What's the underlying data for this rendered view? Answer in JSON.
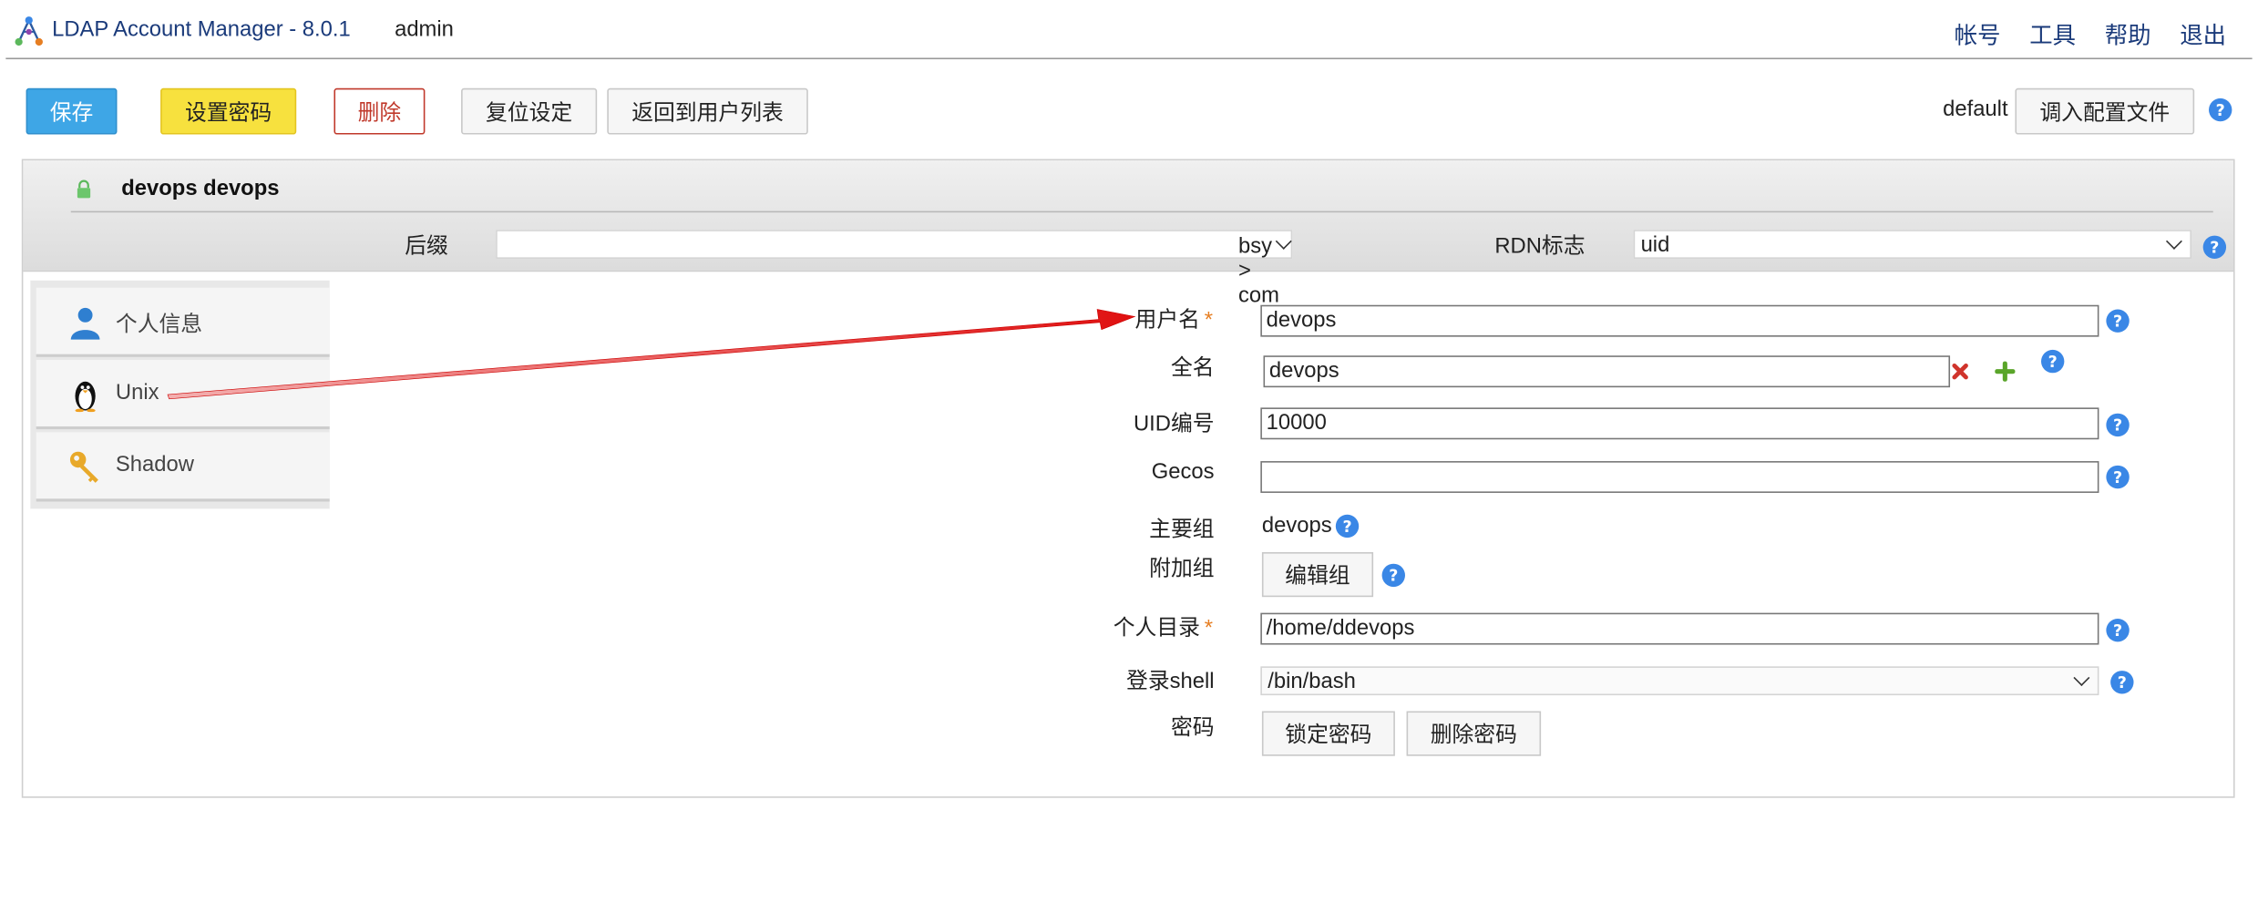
{
  "app": {
    "title": "LDAP Account Manager - 8.0.1",
    "user": "admin"
  },
  "nav": [
    "帐号",
    "工具",
    "帮助",
    "退出"
  ],
  "toolbar": {
    "save": "保存",
    "set_password": "设置密码",
    "delete": "删除",
    "reset": "复位设定",
    "back": "返回到用户列表",
    "profile_name": "default",
    "load_profile": "调入配置文件"
  },
  "entry": {
    "title": "devops devops",
    "suffix_label": "后缀",
    "suffix_value": "bsy > com",
    "rdn_label": "RDN标志",
    "rdn_value": "uid"
  },
  "tabs": [
    {
      "label": "个人信息",
      "icon": "person-icon"
    },
    {
      "label": "Unix",
      "icon": "penguin-icon"
    },
    {
      "label": "Shadow",
      "icon": "key-icon"
    }
  ],
  "form": {
    "username_label": "用户名",
    "username": "devops",
    "fullname_label": "全名",
    "fullname": "devops",
    "uid_label": "UID编号",
    "uid": "10000",
    "gecos_label": "Gecos",
    "gecos": "",
    "primary_group_label": "主要组",
    "primary_group": "devops",
    "additional_groups_label": "附加组",
    "edit_groups": "编辑组",
    "home_label": "个人目录",
    "home": "/home/ddevops",
    "shell_label": "登录shell",
    "shell": "/bin/bash",
    "password_label": "密码",
    "lock_password": "锁定密码",
    "remove_password": "删除密码"
  },
  "required_mark": "*",
  "help_glyph": "?",
  "colors": {
    "primary": "#3ea6e6",
    "warning": "#f7e13e",
    "danger": "#c0392b",
    "help": "#3a87e6",
    "annotation": "#e01010"
  }
}
